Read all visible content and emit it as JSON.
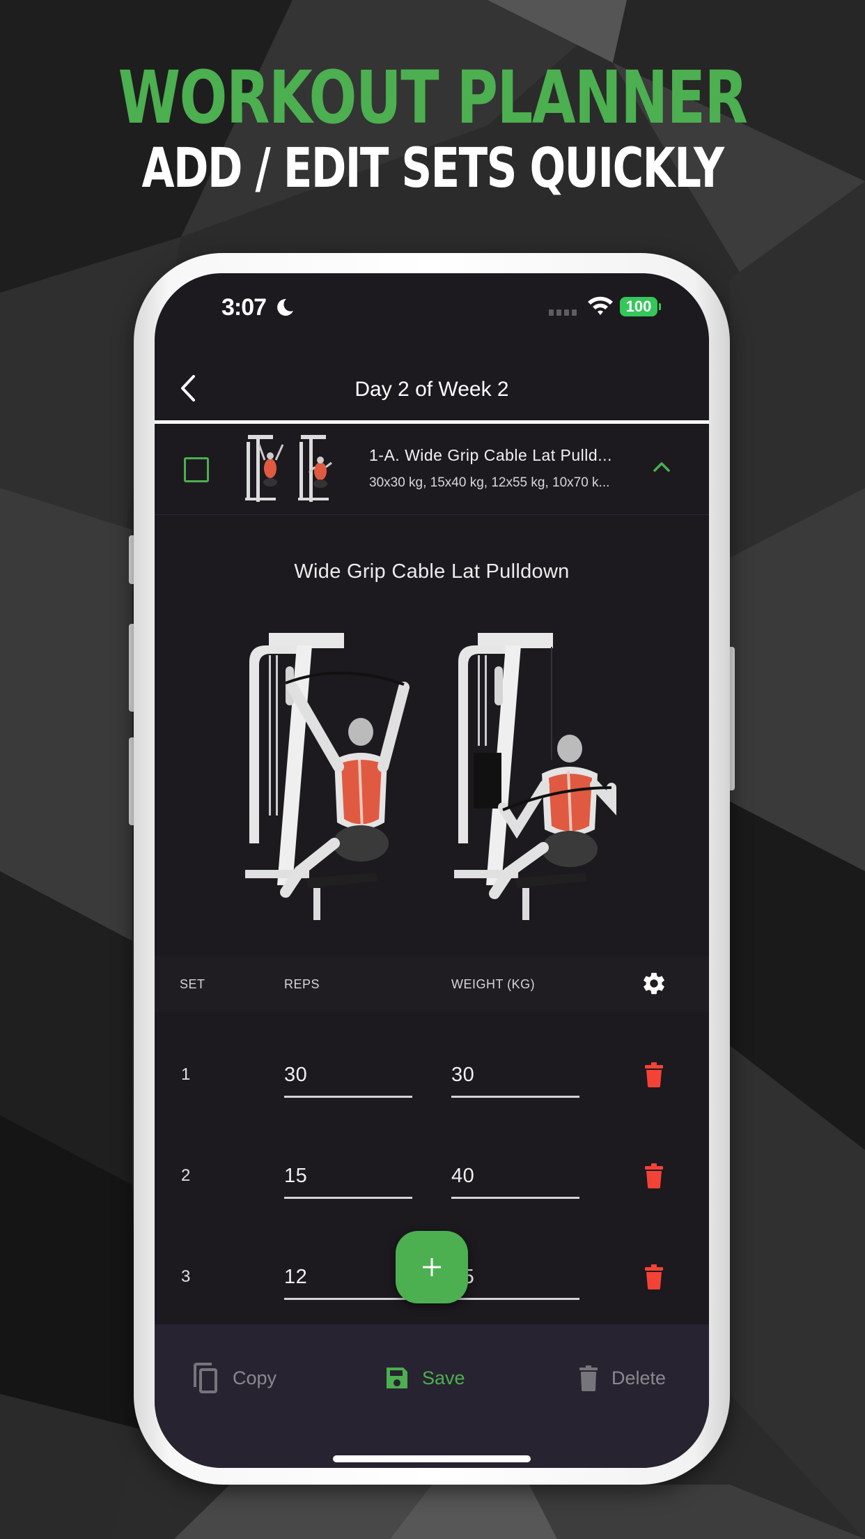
{
  "promo": {
    "headline": "WORKOUT PLANNER",
    "subheadline": "ADD / EDIT SETS QUICKLY"
  },
  "colors": {
    "accent": "#4caf50",
    "danger": "#f44336",
    "screen_bg": "#1c1a1f",
    "bottom_bar_bg": "#272330",
    "battery": "#34c759"
  },
  "status_bar": {
    "time": "3:07",
    "focus_icon": "moon-icon",
    "battery_level": "100",
    "wifi_icon": "wifi-icon"
  },
  "navbar": {
    "back_icon": "chevron-left-icon",
    "title": "Day 2 of Week 2"
  },
  "exercise_row": {
    "completed": false,
    "name": "1-A. Wide Grip Cable Lat Pulld...",
    "sets_summary": "30x30 kg, 15x40 kg, 12x55 kg, 10x70 k...",
    "expanded": true
  },
  "detail": {
    "title": "Wide Grip Cable Lat Pulldown",
    "image_alt": "Wide grip cable lat pulldown exercise illustration, start and end positions"
  },
  "sets_table": {
    "headers": {
      "set": "SET",
      "reps": "REPS",
      "weight": "WEIGHT (KG)"
    },
    "settings_icon": "gear-icon",
    "rows": [
      {
        "set": "1",
        "reps": "30",
        "weight": "30"
      },
      {
        "set": "2",
        "reps": "15",
        "weight": "40"
      },
      {
        "set": "3",
        "reps": "12",
        "weight": "55"
      }
    ]
  },
  "fab": {
    "icon": "plus-icon",
    "label": "Add set"
  },
  "bottom_bar": {
    "copy": "Copy",
    "save": "Save",
    "delete": "Delete"
  }
}
